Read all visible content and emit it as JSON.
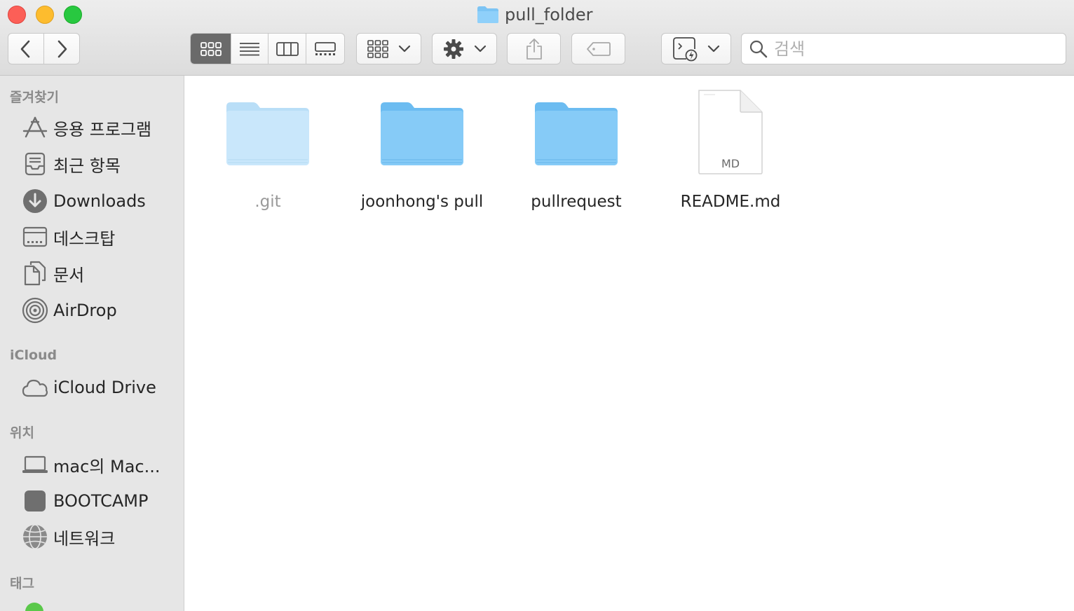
{
  "window": {
    "title": "pull_folder"
  },
  "toolbar": {
    "search_placeholder": "검색",
    "view_modes": [
      {
        "id": "icon",
        "active": true
      },
      {
        "id": "list",
        "active": false
      },
      {
        "id": "column",
        "active": false
      },
      {
        "id": "gallery",
        "active": false
      }
    ]
  },
  "sidebar": {
    "favorites_header": "즐겨찾기",
    "favorites": [
      {
        "label": "응용 프로그램",
        "icon": "applications-icon"
      },
      {
        "label": "최근 항목",
        "icon": "recents-icon"
      },
      {
        "label": "Downloads",
        "icon": "downloads-icon"
      },
      {
        "label": "데스크탑",
        "icon": "desktop-icon"
      },
      {
        "label": "문서",
        "icon": "documents-icon"
      },
      {
        "label": "AirDrop",
        "icon": "airdrop-icon"
      }
    ],
    "icloud_header": "iCloud",
    "icloud": [
      {
        "label": "iCloud Drive",
        "icon": "cloud-icon"
      }
    ],
    "locations_header": "위치",
    "locations": [
      {
        "label": "mac의 Mac...",
        "icon": "laptop-icon"
      },
      {
        "label": "BOOTCAMP",
        "icon": "disk-icon"
      },
      {
        "label": "네트워크",
        "icon": "network-icon"
      }
    ],
    "tags_header": "태그",
    "tag_colors": {
      "green": "#5ac84a"
    }
  },
  "files": [
    {
      "name": ".git",
      "type": "folder",
      "hidden": true
    },
    {
      "name": "joonhong's pull",
      "type": "folder",
      "hidden": false
    },
    {
      "name": "pullrequest",
      "type": "folder",
      "hidden": false
    },
    {
      "name": "README.md",
      "type": "document",
      "badge": "MD",
      "hidden": false
    }
  ],
  "colors": {
    "folder": "#7cc4f4",
    "folder_hidden": "#c5e5fa",
    "active_segment": "#6a6a6a"
  }
}
